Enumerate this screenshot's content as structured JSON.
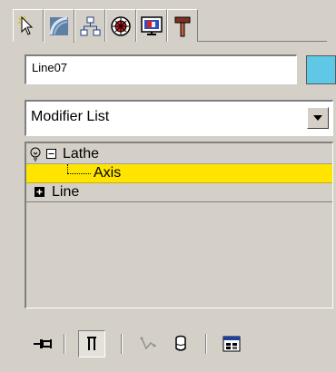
{
  "panel": {
    "tabs": [
      {
        "icon": "create-cursor-icon",
        "active": false
      },
      {
        "icon": "modify-curve-icon",
        "active": true
      },
      {
        "icon": "hierarchy-icon",
        "active": false
      },
      {
        "icon": "motion-icon",
        "active": false
      },
      {
        "icon": "display-monitor-icon",
        "active": false
      },
      {
        "icon": "utilities-hammer-icon",
        "active": false
      }
    ]
  },
  "object": {
    "name": "Line07",
    "color": "#5ec8e6"
  },
  "modifier_list": {
    "label": "Modifier List"
  },
  "stack": {
    "lathe_label": "Lathe",
    "axis_label": "Axis",
    "line_label": "Line",
    "selected_color": "#ffe400"
  },
  "toolbar": {
    "buttons": [
      {
        "icon": "pin-stack-icon",
        "pressed": false
      },
      {
        "icon": "show-end-result-icon",
        "pressed": true
      },
      {
        "icon": "make-unique-icon",
        "pressed": false
      },
      {
        "icon": "remove-modifier-icon",
        "pressed": false
      },
      {
        "icon": "configure-modifier-sets-icon",
        "pressed": false
      }
    ]
  }
}
